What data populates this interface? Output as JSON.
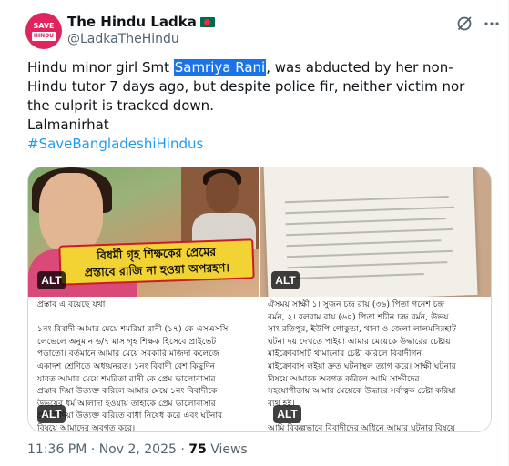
{
  "account": {
    "display_name": "The Hindu Ladka",
    "handle": "@LadkaTheHindu",
    "verified_flag_icon": "bangladesh-flag-icon",
    "avatar_lines": [
      "SAVE",
      "HINDU"
    ]
  },
  "actions": {
    "grok_icon": "grok-icon",
    "more_icon": "more-icon"
  },
  "tweet": {
    "text_before_highlight": "Hindu minor girl Smt ",
    "highlight": "Samriya Rani",
    "text_after_highlight": ", was abducted by her non-Hindu tutor 7 days ago, but despite police fir, neither victim nor the culprit is tracked down.",
    "location": "Lalmanirhat",
    "hashtag": "#SaveBangladeshiHindus"
  },
  "media": {
    "alt_label": "ALT",
    "banner_line1": "বিধর্মী গৃহ শিক্ষকের প্রেমের",
    "banner_line2": "প্রস্তাবে রাজি না হওয়া অপরহণ।",
    "left_scan_lines": [
      "প্রস্তাব এ বয়েছে যথা",
      "",
      "১নং বিবাদী আমার মেয়ে শমরিয়া রানী (১৭) কে এসএসসি",
      "লেভেলে অনুমান ৬/৭ মাস গৃহ শিক্ষক হিসেবে প্রাইভেট",
      "পড়াতো। বর্তমানে আমার মেয়ে সরকারি মজিদা কলেজে",
      "একাদশ শ্রেণিতে অধ্যয়নরত। ১নং বিবাদী বেশ কিছুদিন",
      "যাবত আমার মেয়ে শমরিতা রানী কে প্রেম ভালোবাসার",
      "প্রস্তাব দিয়া উত্যক্ত করিলে আমার মেয়ে ১নং বিবাদীকে",
      "উভয়ের ধর্ম আলাদা হওয়ায় তাহাকে প্রেম ভালোবাসার",
      "প্রস্তাব দিয়া উত্যক্ত করিতে বাধা নিষেধ করে এবং ঘটনার",
      "বিষয়ে আমাদের অবগত করে।"
    ],
    "right_scan_lines": [
      "ঐসময় সাক্ষী ১। সুজন চন্দ্র রায় (৩৬) পিতা গনেশ চন্দ্র",
      "বর্মন, ২। বলরাম রায় (৬০) পিতা শচীন চন্দ্র বর্মন, উভয়",
      "সাং রতিপুর, ইউপি-গোকুন্ডা, থানা ও জেলা-লালমনিরহাট",
      "ঘটনা দয় দেখতে পাইয়া আমার মেয়েকে উদ্ধারের চেষ্টায়",
      "মাইক্রোবাসটি থামানোর চেষ্টা করিলে বিবাদীগন",
      "মাইক্রোবাস লইয়া দ্রুত ঘটনাস্থল ত্যাগ করে। সাক্ষী ঘটনার",
      "বিষয়ে আমাকে অবগত করিলে আমি সাক্ষীদের",
      "সহযোগীতায় আমার মেয়েকে উদ্ধারে সর্বাত্বক চেষ্টা করিয়া",
      "ব্যর্থ হই।",
      "",
      "আমি বিকল্পভাবে বিবাদীদের অধিনে আমার ঘটনার বিষয়ে"
    ]
  },
  "meta": {
    "time": "11:36 PM",
    "separator": "·",
    "date": "Nov 2, 2025",
    "views_count": "75",
    "views_label": "Views"
  }
}
